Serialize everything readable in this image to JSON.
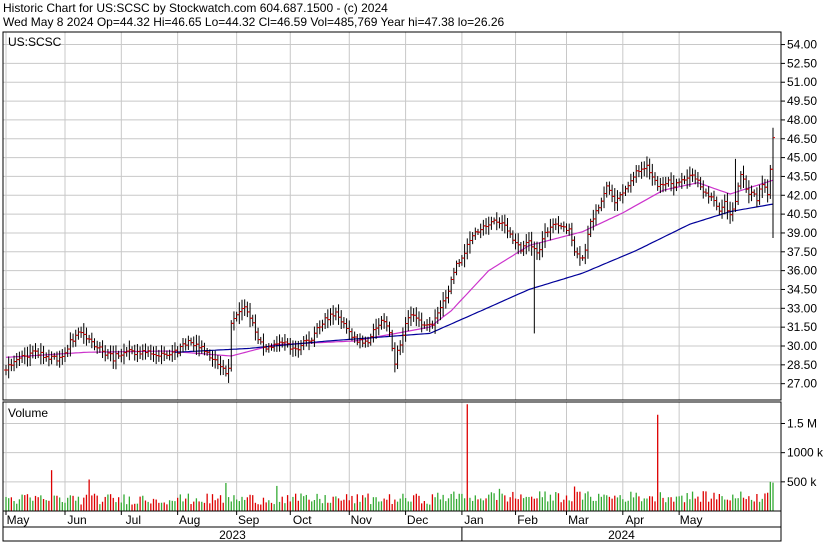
{
  "header": {
    "line1": "Historic Chart for US:SCSC by Stockwatch.com 604.687.1500 - (c) 2024",
    "line2": "Wed May  8 2024   Op=44.32   Hi=46.65   Lo=44.32   Cl=46.59   Vol=485,769   Year hi=47.38   lo=26.26"
  },
  "colors": {
    "frame": "#000000",
    "grid": "#c8c8c8",
    "bar": "#000000",
    "tick_mark": "#cc0000",
    "ma_short": "#cc33cc",
    "ma_long": "#000099",
    "vol_up": "#33aa33",
    "vol_down": "#dd0000"
  },
  "chart_data": [
    {
      "type": "ohlc",
      "title": "US:SCSC",
      "y_ticks": [
        27.0,
        28.5,
        30.0,
        31.5,
        33.0,
        34.5,
        36.0,
        37.5,
        39.0,
        40.5,
        42.0,
        43.5,
        45.0,
        46.5,
        48.0,
        49.5,
        51.0,
        52.5,
        54.0
      ],
      "y_tick_labels": [
        "27.00",
        "28.50",
        "30.00",
        "31.50",
        "33.00",
        "34.50",
        "36.00",
        "37.50",
        "39.00",
        "40.50",
        "42.00",
        "43.50",
        "45.00",
        "46.50",
        "48.00",
        "49.50",
        "51.00",
        "52.50",
        "54.00"
      ],
      "ylim": [
        25.7,
        55.0
      ],
      "grid": true,
      "anchor_closes": [
        [
          0,
          28.3
        ],
        [
          5,
          29.0
        ],
        [
          10,
          29.6
        ],
        [
          15,
          29.2
        ],
        [
          20,
          29.0
        ],
        [
          25,
          30.6
        ],
        [
          28,
          31.0
        ],
        [
          31,
          30.3
        ],
        [
          36,
          29.6
        ],
        [
          40,
          29.0
        ],
        [
          44,
          29.6
        ],
        [
          48,
          29.5
        ],
        [
          52,
          29.6
        ],
        [
          56,
          29.2
        ],
        [
          60,
          29.5
        ],
        [
          64,
          29.6
        ],
        [
          68,
          30.5
        ],
        [
          71,
          30.0
        ],
        [
          74,
          29.6
        ],
        [
          77,
          29.0
        ],
        [
          80,
          28.5
        ],
        [
          82,
          27.9
        ],
        [
          83,
          28.1
        ],
        [
          84,
          31.6
        ],
        [
          86,
          32.4
        ],
        [
          88,
          33.0
        ],
        [
          90,
          32.8
        ],
        [
          93,
          31.0
        ],
        [
          96,
          29.9
        ],
        [
          100,
          30.2
        ],
        [
          104,
          30.1
        ],
        [
          108,
          29.6
        ],
        [
          111,
          30.4
        ],
        [
          114,
          30.7
        ],
        [
          117,
          31.6
        ],
        [
          120,
          32.3
        ],
        [
          123,
          32.7
        ],
        [
          126,
          31.6
        ],
        [
          129,
          30.9
        ],
        [
          132,
          30.3
        ],
        [
          135,
          30.2
        ],
        [
          138,
          31.6
        ],
        [
          141,
          32.0
        ],
        [
          143,
          30.9
        ],
        [
          145,
          28.6
        ],
        [
          147,
          30.3
        ],
        [
          150,
          32.5
        ],
        [
          153,
          32.1
        ],
        [
          156,
          31.5
        ],
        [
          159,
          31.7
        ],
        [
          162,
          33.0
        ],
        [
          165,
          34.5
        ],
        [
          168,
          36.5
        ],
        [
          171,
          37.4
        ],
        [
          174,
          38.8
        ],
        [
          177,
          39.2
        ],
        [
          180,
          39.6
        ],
        [
          183,
          39.9
        ],
        [
          186,
          39.7
        ],
        [
          189,
          38.6
        ],
        [
          192,
          37.7
        ],
        [
          195,
          38.5
        ],
        [
          198,
          37.2
        ],
        [
          201,
          39.2
        ],
        [
          204,
          39.5
        ],
        [
          207,
          39.7
        ],
        [
          210,
          39.3
        ],
        [
          212,
          37.7
        ],
        [
          214,
          36.9
        ],
        [
          216,
          37.4
        ],
        [
          218,
          39.9
        ],
        [
          221,
          41.2
        ],
        [
          224,
          42.6
        ],
        [
          227,
          41.5
        ],
        [
          230,
          42.1
        ],
        [
          233,
          43.2
        ],
        [
          236,
          44.1
        ],
        [
          239,
          44.5
        ],
        [
          241,
          43.6
        ],
        [
          243,
          42.6
        ],
        [
          246,
          43.1
        ],
        [
          249,
          42.9
        ],
        [
          252,
          43.3
        ],
        [
          255,
          43.7
        ],
        [
          258,
          43.1
        ],
        [
          261,
          42.2
        ],
        [
          264,
          41.5
        ],
        [
          266,
          40.9
        ],
        [
          268,
          41.3
        ],
        [
          270,
          40.6
        ],
        [
          272,
          41.6
        ],
        [
          274,
          43.9
        ],
        [
          276,
          42.4
        ],
        [
          278,
          42.2
        ],
        [
          280,
          41.6
        ],
        [
          282,
          42.9
        ],
        [
          284,
          42.3
        ],
        [
          285,
          44.0
        ],
        [
          286,
          46.59
        ]
      ],
      "ma_short": [
        [
          0,
          29.1
        ],
        [
          30,
          29.5
        ],
        [
          60,
          29.6
        ],
        [
          84,
          29.2
        ],
        [
          100,
          30.1
        ],
        [
          130,
          30.4
        ],
        [
          158,
          31.5
        ],
        [
          166,
          32.8
        ],
        [
          180,
          36.0
        ],
        [
          195,
          38.0
        ],
        [
          215,
          39.1
        ],
        [
          230,
          40.6
        ],
        [
          245,
          42.4
        ],
        [
          258,
          43.0
        ],
        [
          270,
          42.1
        ],
        [
          286,
          43.2
        ]
      ],
      "ma_long": [
        [
          63,
          29.5
        ],
        [
          90,
          29.8
        ],
        [
          120,
          30.4
        ],
        [
          158,
          31.0
        ],
        [
          175,
          32.6
        ],
        [
          195,
          34.5
        ],
        [
          215,
          35.8
        ],
        [
          235,
          37.6
        ],
        [
          255,
          39.7
        ],
        [
          270,
          40.7
        ],
        [
          286,
          41.3
        ]
      ]
    },
    {
      "type": "bar",
      "title": "Volume",
      "y_ticks": [
        500,
        1000,
        1500
      ],
      "y_tick_labels": [
        "500 k",
        "1000 k",
        "1.5 M"
      ],
      "ylim": [
        0,
        1800
      ],
      "units": "thousands of shares",
      "spikes": [
        [
          17,
          700,
          "down"
        ],
        [
          31,
          540,
          "down"
        ],
        [
          82,
          480,
          "up"
        ],
        [
          101,
          430,
          "up"
        ],
        [
          172,
          1830,
          "down"
        ],
        [
          184,
          380,
          "up"
        ],
        [
          212,
          420,
          "down"
        ],
        [
          243,
          1650,
          "down"
        ],
        [
          285,
          500,
          "up"
        ],
        [
          286,
          486,
          "up"
        ]
      ],
      "x_tick_labels": [
        "May",
        "Jun",
        "Jul",
        "Aug",
        "Sep",
        "Oct",
        "Nov",
        "Dec",
        "Jan",
        "Feb",
        "Mar",
        "Apr",
        "May"
      ],
      "x_ticks_day": [
        0,
        22,
        43,
        64,
        86,
        106,
        128,
        149,
        170,
        190,
        209,
        230,
        251
      ],
      "year_labels": [
        "2023",
        "2024"
      ]
    }
  ]
}
